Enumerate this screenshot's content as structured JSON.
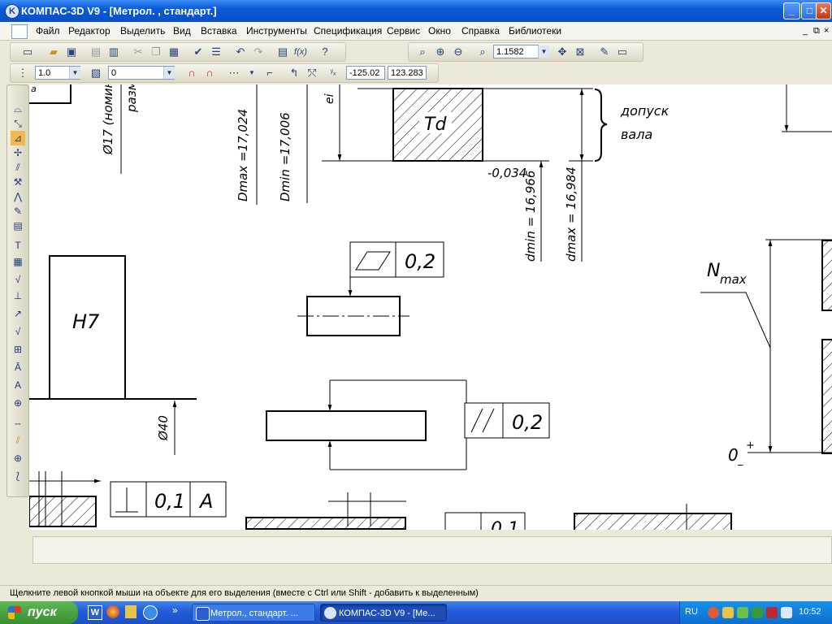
{
  "window": {
    "title": "КОМПАС-3D V9 - [Метрол. , стандарт.]"
  },
  "titlebar_buttons": {
    "minimize": "_",
    "maximize": "□",
    "close": "✕"
  },
  "menu": {
    "items": [
      "Файл",
      "Редактор",
      "Выделить",
      "Вид",
      "Вставка",
      "Инструменты",
      "Спецификация",
      "Сервис",
      "Окно",
      "Справка",
      "Библиотеки"
    ],
    "mdi_controls": [
      "_",
      "⧉",
      "×"
    ]
  },
  "toolbar": {
    "zoom_value": "1.1582",
    "line_scale": "1.0",
    "layer": "0",
    "coord_x": "-125.02",
    "coord_y": "123.283"
  },
  "drawing": {
    "left_top_letter": "a",
    "nominal_rot": "Ø17 (номин",
    "razm_rot": "разм",
    "ei_label": "ei",
    "dmax_big": "Dmax =17,024",
    "dmin_big": "Dmin =17,006",
    "td_label": "Td",
    "dopusk": "допуск",
    "vala": "вала",
    "lower_dev": "-0,034",
    "dmin_small": "dmin = 16,966",
    "dmax_small": "dmax = 16,984",
    "flatness_value": "0,2",
    "parallel_value": "0,2",
    "h7": "H7",
    "d40": "Ø40",
    "perp_value": "0,1",
    "perp_base": "A",
    "partial_value": "0,1",
    "nmax": "N",
    "nmax_sub": "max",
    "zero_label": "0",
    "zero_plus": "+",
    "zero_minus": "_"
  },
  "statusbar": {
    "hint": "Щелкните левой кнопкой мыши на объекте для его выделения (вместе с Ctrl или Shift - добавить к выделенным)"
  },
  "taskbar": {
    "start": "пуск",
    "tasks": [
      "Метрол., стандарт. ...",
      "КОМПАС-3D V9 - [Ме..."
    ],
    "lang": "RU",
    "clock": "10:52"
  },
  "colors": {
    "accent": "#0a5bd8",
    "taskbar": "#245edb",
    "start": "#3a8f2f"
  }
}
